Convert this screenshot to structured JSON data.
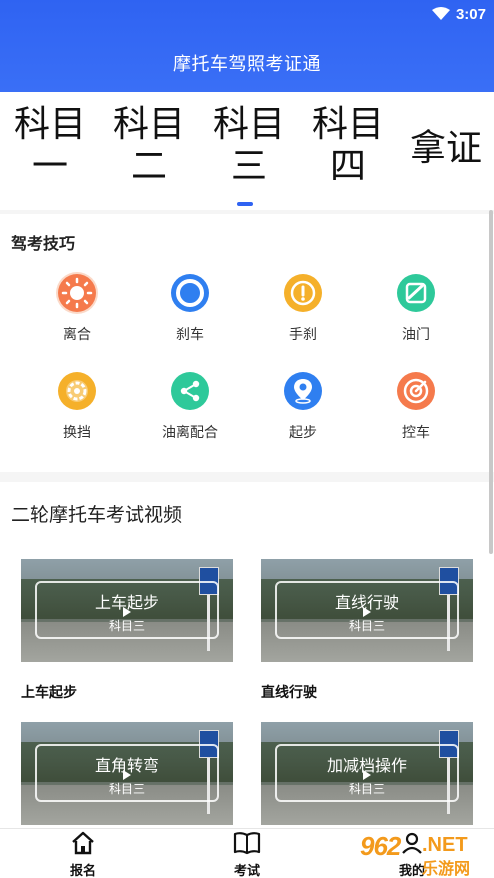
{
  "status_bar": {
    "time": "3:07"
  },
  "header": {
    "title": "摩托车驾照考证通"
  },
  "subject_tabs": [
    {
      "line1": "科目",
      "line2": "一"
    },
    {
      "line1": "科目",
      "line2": "二"
    },
    {
      "line1": "科目",
      "line2": "三"
    },
    {
      "line1": "科目",
      "line2": "四"
    },
    {
      "line1": "拿证",
      "line2": ""
    }
  ],
  "skills": {
    "title": "驾考技巧",
    "items": [
      {
        "label": "离合",
        "icon": "sun-icon",
        "color": "#f57a4c"
      },
      {
        "label": "刹车",
        "icon": "brake-ring-icon",
        "color": "#2f7ff0"
      },
      {
        "label": "手刹",
        "icon": "warning-icon",
        "color": "#f5b02a"
      },
      {
        "label": "油门",
        "icon": "pedal-icon",
        "color": "#2ec99a"
      },
      {
        "label": "换挡",
        "icon": "gear-icon",
        "color": "#f5b02a"
      },
      {
        "label": "油离配合",
        "icon": "share-icon",
        "color": "#2ec99a"
      },
      {
        "label": "起步",
        "icon": "location-icon",
        "color": "#2f7ff0"
      },
      {
        "label": "控车",
        "icon": "target-icon",
        "color": "#f57a4c"
      }
    ]
  },
  "videos": {
    "heading": "二轮摩托车考试视频",
    "items": [
      {
        "overlay_title": "上车起步",
        "overlay_sub": "科目三",
        "caption": "上车起步"
      },
      {
        "overlay_title": "直线行驶",
        "overlay_sub": "科目三",
        "caption": "直线行驶"
      },
      {
        "overlay_title": "直角转弯",
        "overlay_sub": "科目三",
        "caption": ""
      },
      {
        "overlay_title": "加减档操作",
        "overlay_sub": "科目三",
        "caption": ""
      }
    ]
  },
  "bottom_nav": [
    {
      "label": "报名",
      "icon": "home-icon"
    },
    {
      "label": "考试",
      "icon": "book-icon"
    },
    {
      "label": "我的",
      "icon": "user-icon"
    }
  ],
  "watermark": {
    "number": "962",
    "net": ".NET",
    "cn": "乐游网"
  }
}
